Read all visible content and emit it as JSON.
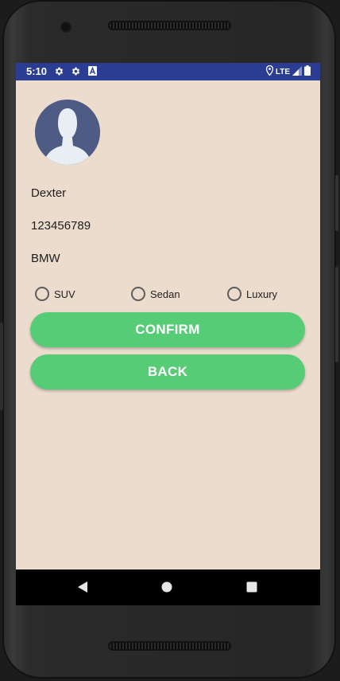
{
  "status_bar": {
    "time": "5:10",
    "network": "LTE",
    "left_icons": [
      "gear-icon",
      "gear-icon",
      "a-icon"
    ],
    "right_icons": [
      "location-icon",
      "signal-icon",
      "battery-icon"
    ],
    "color": "#2b3d93"
  },
  "profile": {
    "avatar_icon": "user-avatar-icon",
    "name": "Dexter",
    "phone": "123456789",
    "car": "BMW"
  },
  "vehicle_type": {
    "options": [
      {
        "label": "SUV",
        "selected": false
      },
      {
        "label": "Sedan",
        "selected": false
      },
      {
        "label": "Luxury",
        "selected": false
      }
    ]
  },
  "buttons": {
    "confirm_label": "CONFIRM",
    "back_label": "BACK",
    "color": "#56cc76"
  },
  "nav": {
    "icons": [
      "back-triangle-icon",
      "home-circle-icon",
      "recents-square-icon"
    ]
  },
  "theme": {
    "background": "#ebdccd"
  }
}
